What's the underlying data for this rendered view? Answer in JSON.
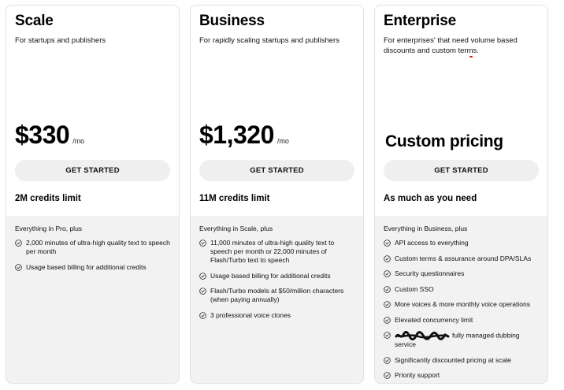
{
  "plans": [
    {
      "title": "Scale",
      "description": "For startups and publishers",
      "price": "$330",
      "price_unit": "/mo",
      "cta": "GET STARTED",
      "credits": "2M credits limit",
      "features_intro": "Everything in Pro, plus",
      "features": [
        "2,000 minutes of ultra-high quality text to speech per month",
        "Usage based billing for additional credits"
      ]
    },
    {
      "title": "Business",
      "description": "For rapidly scaling startups and publishers",
      "price": "$1,320",
      "price_unit": "/mo",
      "cta": "GET STARTED",
      "credits": "11M credits limit",
      "features_intro": "Everything in Scale, plus",
      "features": [
        "11,000 minutes of ultra-high quality text to speech per month or 22,000 minutes of Flash/Turbo text to speech",
        "Usage based billing for additional credits",
        "Flash/Turbo models at $50/million characters (when paying annually)",
        "3 professional voice clones"
      ]
    },
    {
      "title": "Enterprise",
      "description_before": "For enterprises' that need ",
      "description_highlight": "volume based discounts",
      "description_after": " and custom terms.",
      "price_text": "Custom pricing",
      "cta": "GET STARTED",
      "credits": "As much as you need",
      "features_intro": "Everything in Business, plus",
      "features": [
        "API access to everything",
        "Custom terms & assurance around DPA/SLAs",
        "Security questionnaires",
        "Custom SSO",
        "More voices & more monthly voice operations",
        "Elevated concurrency limit",
        "fully managed dubbing service",
        "Significantly discounted pricing at scale",
        "Priority support"
      ]
    }
  ],
  "colors": {
    "highlight_underline": "#d6141f",
    "button_bg": "#efefef",
    "features_bg": "#f2f2f2"
  }
}
